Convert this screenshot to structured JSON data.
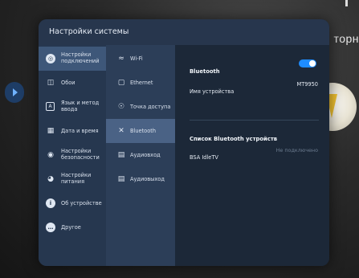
{
  "background": {
    "text": "торн"
  },
  "panel": {
    "title": "Настройки системы"
  },
  "left_menu": [
    {
      "label": "Настройки\nподключений",
      "icon": "globe-icon",
      "active": true
    },
    {
      "label": "Обои",
      "icon": "wallpaper-icon",
      "active": false
    },
    {
      "label": "Язык и метод\nввода",
      "icon": "language-icon",
      "active": false
    },
    {
      "label": "Дата и время",
      "icon": "calendar-icon",
      "active": false
    },
    {
      "label": "Настройки\nбезопасности",
      "icon": "security-icon",
      "active": false
    },
    {
      "label": "Настройки\nпитания",
      "icon": "power-icon",
      "active": false
    },
    {
      "label": "Об устройстве",
      "icon": "info-icon",
      "active": false
    },
    {
      "label": "Другое",
      "icon": "more-icon",
      "active": false
    }
  ],
  "sub_menu": [
    {
      "label": "Wi-Fi",
      "icon": "wifi-icon",
      "active": false
    },
    {
      "label": "Ethernet",
      "icon": "ethernet-icon",
      "active": false
    },
    {
      "label": "Точка доступа",
      "icon": "hotspot-icon",
      "active": false
    },
    {
      "label": "Bluetooth",
      "icon": "bluetooth-icon",
      "active": true
    },
    {
      "label": "Аудиовход",
      "icon": "audio-in-icon",
      "active": false
    },
    {
      "label": "Аудиовыход",
      "icon": "audio-out-icon",
      "active": false
    }
  ],
  "detail": {
    "bluetooth_label": "Bluetooth",
    "bluetooth_on": true,
    "device_name_label": "Имя устройства",
    "device_name_value": "MT9950",
    "list_title": "Список Bluetooth устройств",
    "devices": [
      {
        "name": "BSA IdleTV",
        "status": "Не подключено"
      }
    ]
  },
  "colors": {
    "panel_bg": "#1b2533",
    "toggle_accent": "#1e8cff",
    "active_menu": "#3e5779",
    "active_submenu": "#4a6285"
  }
}
